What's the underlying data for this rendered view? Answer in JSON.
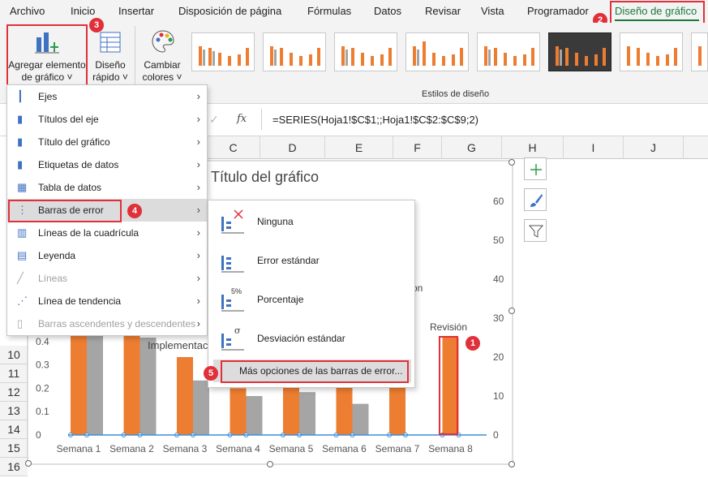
{
  "tabs": [
    "Archivo",
    "Inicio",
    "Insertar",
    "Disposición de página",
    "Fórmulas",
    "Datos",
    "Revisar",
    "Vista",
    "Programador",
    "Diseño de gráfico"
  ],
  "ribbon": {
    "add_element_line1": "Agregar elemento",
    "add_element_line2": "de gráfico ˅",
    "quick_layout_line1": "Diseño",
    "quick_layout_line2": "rápido ˅",
    "change_colors_line1": "Cambiar",
    "change_colors_line2": "colores ˅",
    "styles_group_label": "Estilos de diseño"
  },
  "formula_bar": {
    "fx": "fx",
    "check": "✓",
    "formula": "=SERIES(Hoja1!$C$1;;Hoja1!$C$2:$C$9;2)"
  },
  "columns": [
    "C",
    "D",
    "E",
    "F",
    "G",
    "H",
    "I",
    "J"
  ],
  "rows": [
    "10",
    "11",
    "12",
    "13",
    "14",
    "15",
    "16"
  ],
  "menu": {
    "items": [
      {
        "label": "Ejes",
        "icon": "axes-icon",
        "disabled": false
      },
      {
        "label": "Títulos del eje",
        "icon": "axis-titles-icon",
        "disabled": false
      },
      {
        "label": "Título del gráfico",
        "icon": "chart-title-icon",
        "disabled": false
      },
      {
        "label": "Etiquetas de datos",
        "icon": "data-labels-icon",
        "disabled": false
      },
      {
        "label": "Tabla de datos",
        "icon": "data-table-icon",
        "disabled": false
      },
      {
        "label": "Barras de error",
        "icon": "error-bars-icon",
        "disabled": false
      },
      {
        "label": "Líneas de la cuadrícula",
        "icon": "gridlines-icon",
        "disabled": false
      },
      {
        "label": "Leyenda",
        "icon": "legend-icon",
        "disabled": false
      },
      {
        "label": "Líneas",
        "icon": "lines-icon",
        "disabled": true
      },
      {
        "label": "Línea de tendencia",
        "icon": "trendline-icon",
        "disabled": false
      },
      {
        "label": "Barras ascendentes y descendentes",
        "icon": "up-down-bars-icon",
        "disabled": true
      }
    ]
  },
  "submenu": {
    "items": [
      {
        "label": "Ninguna"
      },
      {
        "label": "Error estándar"
      },
      {
        "label": "Porcentaje",
        "icon_text": "5%"
      },
      {
        "label": "Desviación estándar",
        "icon_text": "σ"
      }
    ],
    "more": "Más opciones de las barras de error..."
  },
  "badges": [
    "1",
    "2",
    "3",
    "4",
    "5"
  ],
  "chart": {
    "title": "Título del gráfico",
    "annotation_implementation": "Implementac",
    "annotation_revision": "Revisión",
    "annotation_partial": "on"
  },
  "chart_data": {
    "type": "bar",
    "categories": [
      "Semana 1",
      "Semana 2",
      "Semana 3",
      "Semana 4",
      "Semana 5",
      "Semana 6",
      "Semana 7",
      "Semana 8"
    ],
    "y_left_ticks": [
      "0",
      "0.1",
      "0.2",
      "0.3",
      "0.4"
    ],
    "y_right_ticks": [
      "0",
      "10",
      "20",
      "30",
      "40",
      "50",
      "60"
    ],
    "y_right_lim": [
      0,
      60
    ],
    "series": [
      {
        "values": [
          27,
          26,
          20,
          12,
          14,
          13,
          15,
          25
        ]
      },
      {
        "values": [
          26,
          25,
          14,
          10,
          11,
          8,
          0,
          0
        ]
      }
    ],
    "colors": {
      "orange": "#ed7d31",
      "gray": "#a5a5a5"
    }
  }
}
